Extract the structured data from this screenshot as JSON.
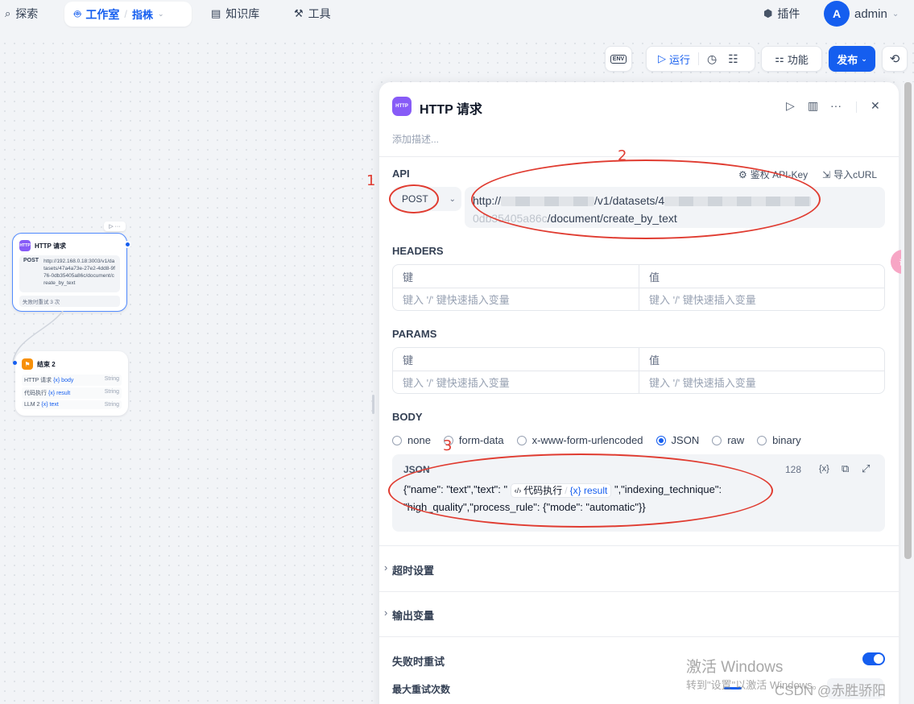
{
  "nav": {
    "explore": "探索",
    "studio": "工作室",
    "app_name": "指株",
    "knowledge": "知识库",
    "tools": "工具",
    "plugins": "插件",
    "avatar_letter": "A",
    "user": "admin"
  },
  "toolbar": {
    "env": "ENV",
    "run": "运行",
    "features": "功能",
    "publish": "发布"
  },
  "canvas": {
    "http_node": {
      "title": "HTTP 请求",
      "icon_text": "HTTP",
      "method": "POST",
      "url": "http://192.168.0.18:3003/v1/datasets/47a4a73e-27e2-4dd8-9f76-0db35405a86c/document/create_by_text",
      "retry": "失败时重试 3 次"
    },
    "end_node": {
      "title": "结束 2",
      "outputs": [
        {
          "source": "HTTP 请求",
          "var": "{x} body",
          "type": "String"
        },
        {
          "source": "代码执行",
          "var": "{x} result",
          "type": "String"
        },
        {
          "source": "LLM 2",
          "var": "{x} text",
          "type": "String"
        }
      ]
    }
  },
  "panel": {
    "icon_text": "HTTP",
    "title": "HTTP 请求",
    "description_placeholder": "添加描述...",
    "api_label": "API",
    "auth_label": "鉴权 API-Key",
    "import_curl": "导入cURL",
    "method": "POST",
    "url_prefix": "http://",
    "url_mid": "/v1/datasets/4",
    "url_line2_prefix": "0db35405a86c",
    "url_line2": "/document/create_by_text",
    "headers_label": "HEADERS",
    "params_label": "PARAMS",
    "key_col": "键",
    "value_col": "值",
    "kv_placeholder": "键入 '/' 键快速插入变量",
    "body_label": "BODY",
    "body_types": [
      {
        "label": "none",
        "selected": false
      },
      {
        "label": "form-data",
        "selected": false
      },
      {
        "label": "x-www-form-urlencoded",
        "selected": false
      },
      {
        "label": "JSON",
        "selected": true
      },
      {
        "label": "raw",
        "selected": false
      },
      {
        "label": "binary",
        "selected": false
      }
    ],
    "json_label": "JSON",
    "json_count": "128",
    "json_var_icon": "{x}",
    "json_code_a": "{\"name\": \"text\",\"text\": \"",
    "json_pill_source": "代码执行",
    "json_pill_var": "{x} result",
    "json_code_b": "\",\"indexing_technique\":",
    "json_code_c": "\"high_quality\",\"process_rule\": {\"mode\": \"automatic\"}}",
    "timeout_label": "超时设置",
    "output_label": "输出变量",
    "retry_label": "失败时重试",
    "max_retry_label": "最大重试次数",
    "retry_enabled": true
  },
  "annotations": [
    "1",
    "2",
    "3"
  ],
  "watermarks": {
    "windows_title": "激活 Windows",
    "windows_sub": "转到\"设置\"以激活 Windows。",
    "csdn": "CSDN @赤胜骄阳"
  },
  "colors": {
    "accent": "#155eef",
    "annotation": "#e03c31",
    "http_icon": "#875bf7",
    "end_icon": "#f79009"
  }
}
